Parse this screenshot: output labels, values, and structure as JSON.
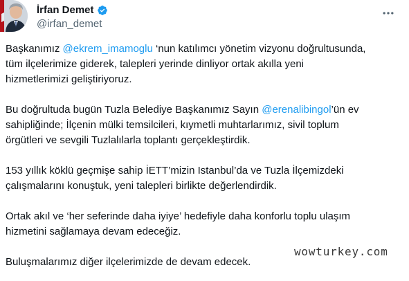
{
  "author": {
    "display_name": "İrfan Demet",
    "handle": "@irfan_demet",
    "verified": true,
    "verified_icon": "verified-badge-icon",
    "avatar_icon": "profile-photo-avatar",
    "accent_color": "#1d9bf0"
  },
  "menu": {
    "icon": "more-options-icon"
  },
  "tweet": {
    "p1": {
      "before": "Başkanımız ",
      "mention": "@ekrem_imamoglu",
      "after": " ‘nun katılımcı yönetim vizyonu doğrultusunda,\ntüm ilçelerimize giderek, talepleri  yerinde dinliyor ortak akılla yeni\nhizmetlerimizi geliştiriyoruz."
    },
    "p2": {
      "before": "Bu doğrultuda bugün Tuzla Belediye Başkanımız Sayın ",
      "mention": "@erenalibingol",
      "after": "’ün ev\nsahipliğinde; İlçenin mülki  temsilcileri, kıymetli muhtarlarımız, sivil toplum\nörgütleri ve sevgili Tuzlalılarla toplantı gerçekleştirdik."
    },
    "p3": "153 yıllık köklü geçmişe sahip İETT’mizin Istanbul’da ve Tuzla  İlçemizdeki\nçalışmalarını konuştuk, yeni talepleri birlikte değerlendirdik.",
    "p4": "Ortak akıl ve ‘her seferinde daha iyiye’ hedefiyle daha konforlu toplu ulaşım\nhizmetini sağlamaya devam edeceğiz.",
    "p5": "Buluşmalarımız diğer ilçelerimizde de devam edecek."
  },
  "watermark": "wowturkey.com"
}
